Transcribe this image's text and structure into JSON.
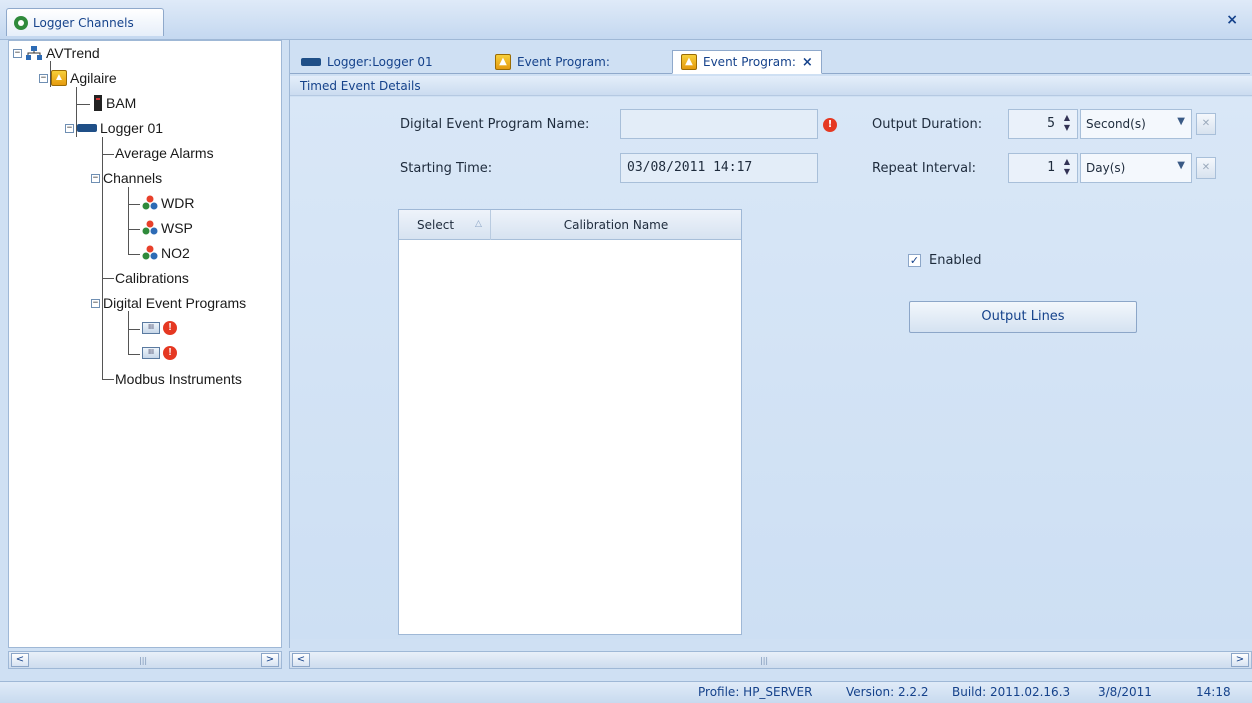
{
  "window": {
    "title": "Logger Channels",
    "close_glyph": "×"
  },
  "tree": {
    "root": "AVTrend",
    "site": "Agilaire",
    "bam": "BAM",
    "logger": "Logger 01",
    "average_alarms": "Average Alarms",
    "channels": "Channels",
    "channel_items": [
      "WDR",
      "WSP",
      "NO2"
    ],
    "calibrations": "Calibrations",
    "digital_event_programs": "Digital Event Programs",
    "modbus_instruments": "Modbus Instruments"
  },
  "tabs": [
    {
      "label": "Logger:Logger 01",
      "icon": "logger-icon"
    },
    {
      "label": "Event Program:",
      "icon": "bell-icon"
    },
    {
      "label": "Event Program:",
      "icon": "bell-icon",
      "active": true
    }
  ],
  "section": {
    "title": "Timed Event Details"
  },
  "form": {
    "name_label": "Digital Event Program Name:",
    "name_value": "",
    "start_label": "Starting Time:",
    "start_value": "03/08/2011  14:17",
    "duration_label": "Output Duration:",
    "duration_value": "5",
    "duration_unit": "Second(s)",
    "repeat_label": "Repeat Interval:",
    "repeat_value": "1",
    "repeat_unit": "Day(s)",
    "enabled_label": "Enabled",
    "enabled": true,
    "output_lines_label": "Output Lines"
  },
  "grid": {
    "columns": [
      "Select",
      "Calibration Name"
    ]
  },
  "status": {
    "profile": "Profile: HP_SERVER",
    "version": "Version: 2.2.2",
    "build": "Build: 2011.02.16.3",
    "date": "3/8/2011",
    "time": "14:18"
  },
  "colors": {
    "accent": "#15428b",
    "panel": "#cfe0f3",
    "error": "#e53822"
  }
}
